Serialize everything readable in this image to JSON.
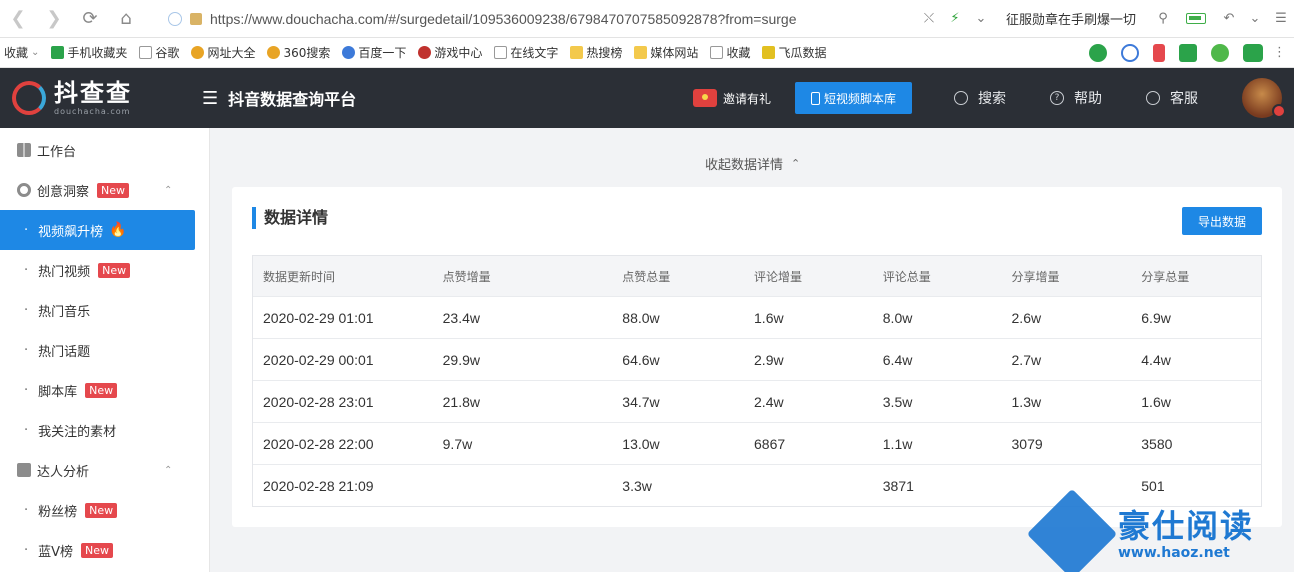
{
  "browser": {
    "url": "https://www.douchacha.com/#/surgedetail/109536009238/6798470707585092878?from=surge",
    "search_hint": "征服勋章在手刷爆一切"
  },
  "bookmarks": [
    {
      "label": "收藏",
      "icon": "star-icon"
    },
    {
      "label": "手机收藏夹",
      "icon": "phone-icon"
    },
    {
      "label": "谷歌",
      "icon": "page-icon"
    },
    {
      "label": "网址大全",
      "icon": "globe-icon"
    },
    {
      "label": "360搜索",
      "icon": "search-icon"
    },
    {
      "label": "百度一下",
      "icon": "paw-icon"
    },
    {
      "label": "游戏中心",
      "icon": "game-icon"
    },
    {
      "label": "在线文字",
      "icon": "page-icon"
    },
    {
      "label": "热搜榜",
      "icon": "folder-icon"
    },
    {
      "label": "媒体网站",
      "icon": "folder-icon"
    },
    {
      "label": "收藏",
      "icon": "page-icon"
    },
    {
      "label": "飞瓜数据",
      "icon": "melon-icon"
    }
  ],
  "header": {
    "logo_text": "抖查查",
    "logo_sub": "douchacha.com",
    "platform_title": "抖音数据查询平台",
    "invite_label": "邀请有礼",
    "script_button": "短视频脚本库",
    "search_label": "搜索",
    "help_label": "帮助",
    "service_label": "客服"
  },
  "sidebar": {
    "workbench": "工作台",
    "creative_group": "创意洞察",
    "creative_items": [
      {
        "label": "视频飙升榜",
        "active": true,
        "new": false,
        "hot": true
      },
      {
        "label": "热门视频",
        "active": false,
        "new": true
      },
      {
        "label": "热门音乐",
        "active": false,
        "new": false
      },
      {
        "label": "热门话题",
        "active": false,
        "new": false
      },
      {
        "label": "脚本库",
        "active": false,
        "new": true
      },
      {
        "label": "我关注的素材",
        "active": false,
        "new": false
      }
    ],
    "talent_group": "达人分析",
    "talent_items": [
      {
        "label": "粉丝榜",
        "new": true
      },
      {
        "label": "蓝V榜",
        "new": true
      }
    ],
    "new_badge": "New"
  },
  "main": {
    "collapse_label": "收起数据详情",
    "card_title": "数据详情",
    "export_button": "导出数据",
    "columns": [
      "数据更新时间",
      "点赞增量",
      "点赞总量",
      "评论增量",
      "评论总量",
      "分享增量",
      "分享总量"
    ],
    "rows": [
      [
        "2020-02-29 01:01",
        "23.4w",
        "88.0w",
        "1.6w",
        "8.0w",
        "2.6w",
        "6.9w"
      ],
      [
        "2020-02-29 00:01",
        "29.9w",
        "64.6w",
        "2.9w",
        "6.4w",
        "2.7w",
        "4.4w"
      ],
      [
        "2020-02-28 23:01",
        "21.8w",
        "34.7w",
        "2.4w",
        "3.5w",
        "1.3w",
        "1.6w"
      ],
      [
        "2020-02-28 22:00",
        "9.7w",
        "13.0w",
        "6867",
        "1.1w",
        "3079",
        "3580"
      ],
      [
        "2020-02-28 21:09",
        "",
        "3.3w",
        "",
        "3871",
        "",
        "501"
      ]
    ]
  },
  "watermark": {
    "title": "豪仕阅读",
    "url": "www.haoz.net"
  },
  "colors": {
    "accent": "#1e88e5",
    "header_bg": "#2b2f36",
    "new_badge": "#e5484d"
  }
}
